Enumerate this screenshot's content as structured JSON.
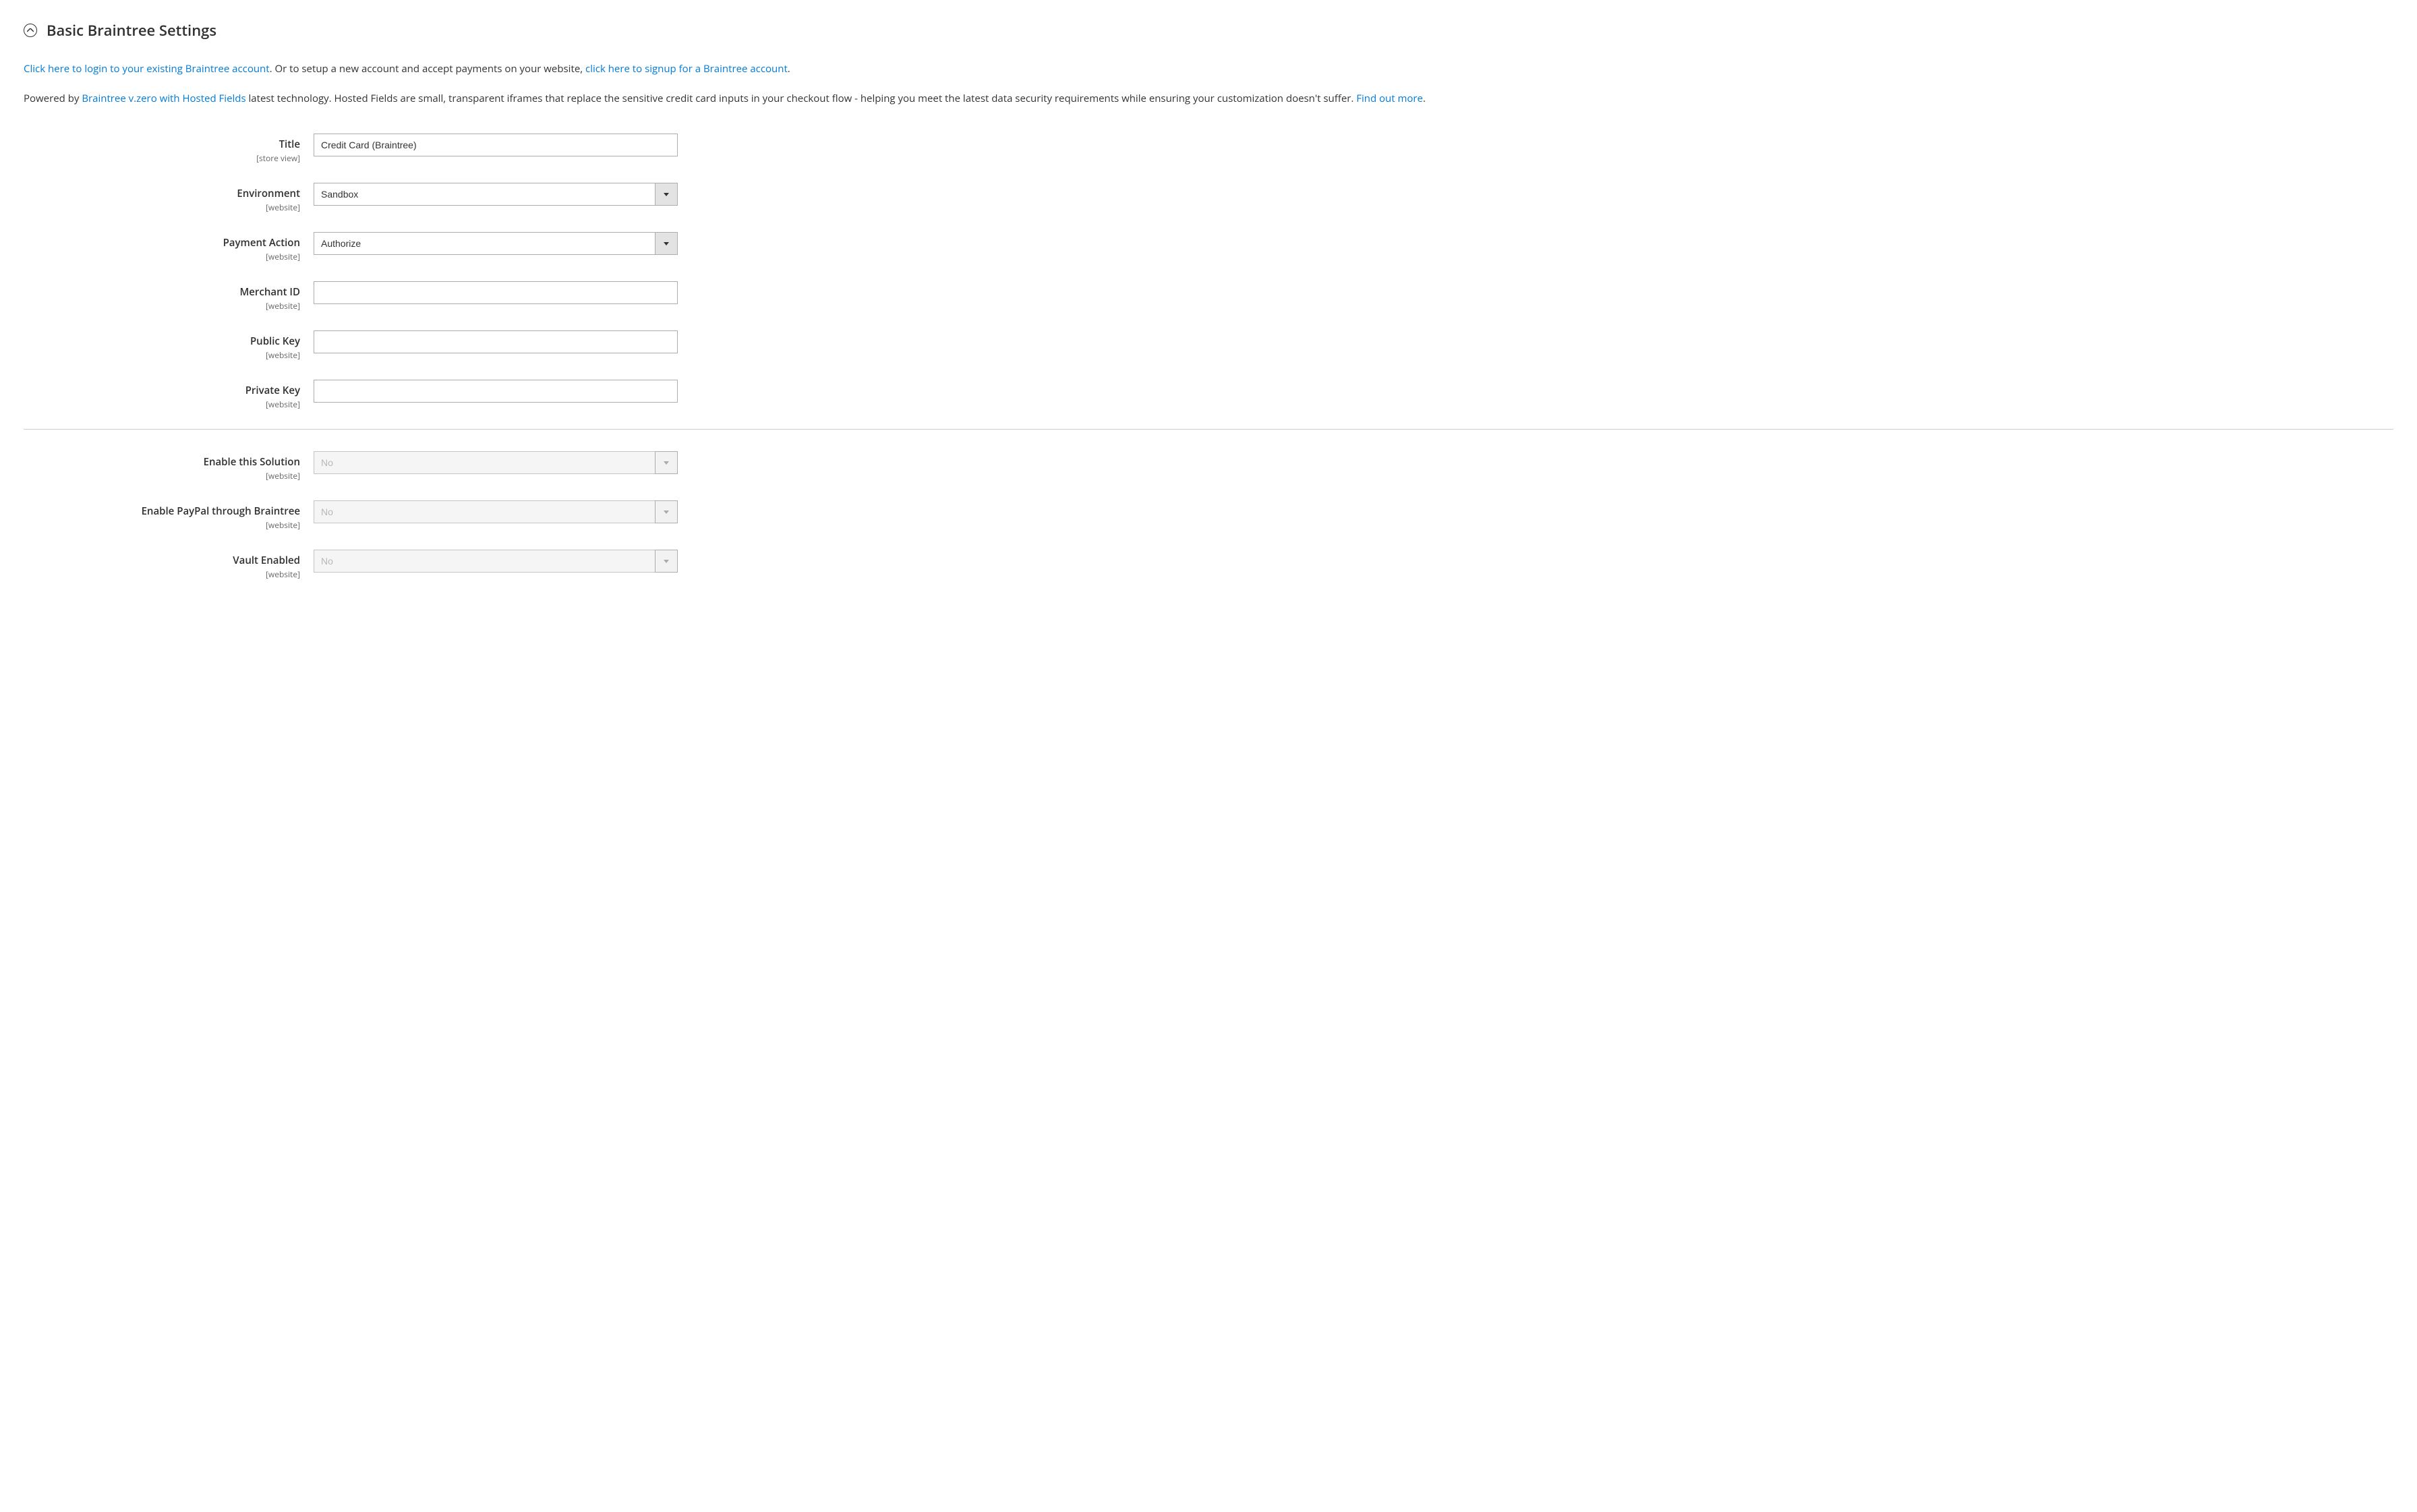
{
  "section": {
    "title": "Basic Braintree Settings"
  },
  "intro": {
    "p1": {
      "link1": "Click here to login to your existing Braintree account",
      "text1": ". Or to setup a new account and accept payments on your website, ",
      "link2": "click here to signup for a Braintree account",
      "text2": "."
    },
    "p2": {
      "text1": "Powered by ",
      "link1": "Braintree v.zero with Hosted Fields",
      "text2": " latest technology. Hosted Fields are small, transparent iframes that replace the sensitive credit card inputs in your checkout flow - helping you meet the latest data security requirements while ensuring your customization doesn't suffer. ",
      "link2": "Find out more",
      "text3": "."
    }
  },
  "fields": {
    "title": {
      "label": "Title",
      "scope": "[store view]",
      "value": "Credit Card (Braintree)"
    },
    "environment": {
      "label": "Environment",
      "scope": "[website]",
      "value": "Sandbox"
    },
    "payment_action": {
      "label": "Payment Action",
      "scope": "[website]",
      "value": "Authorize"
    },
    "merchant_id": {
      "label": "Merchant ID",
      "scope": "[website]",
      "value": ""
    },
    "public_key": {
      "label": "Public Key",
      "scope": "[website]",
      "value": ""
    },
    "private_key": {
      "label": "Private Key",
      "scope": "[website]",
      "value": ""
    },
    "enable_solution": {
      "label": "Enable this Solution",
      "scope": "[website]",
      "value": "No"
    },
    "enable_paypal": {
      "label": "Enable PayPal through Braintree",
      "scope": "[website]",
      "value": "No"
    },
    "vault_enabled": {
      "label": "Vault Enabled",
      "scope": "[website]",
      "value": "No"
    }
  }
}
